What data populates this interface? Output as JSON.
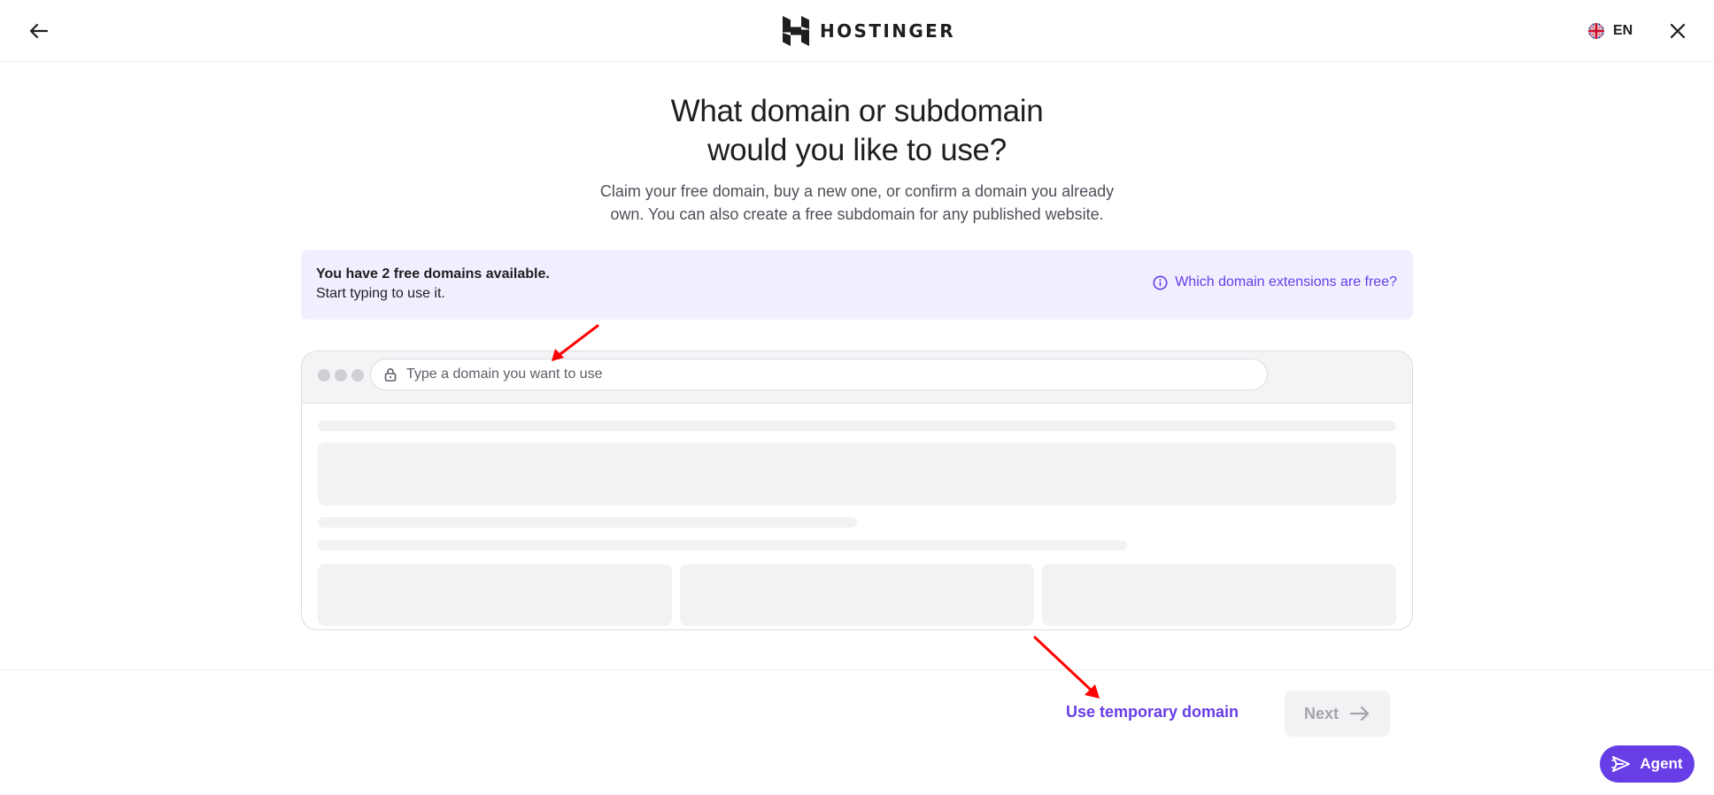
{
  "header": {
    "brand": "HOSTINGER",
    "language": "EN"
  },
  "main": {
    "heading_line1": "What domain or subdomain",
    "heading_line2": "would you like to use?",
    "subtitle_line1": "Claim your free domain, buy a new one, or confirm a domain you already",
    "subtitle_line2": "own. You can also create a free subdomain for any published website."
  },
  "banner": {
    "title": "You have 2 free domains available.",
    "subtitle": "Start typing to use it.",
    "link_label": "Which domain extensions are free?"
  },
  "domain_input": {
    "placeholder": "Type a domain you want to use",
    "value": ""
  },
  "footer": {
    "temporary_domain_label": "Use temporary domain",
    "next_label": "Next",
    "agent_label": "Agent"
  },
  "colors": {
    "accent": "#673de6",
    "banner_bg": "#f1efff",
    "annotation_arrow": "#ff0000"
  },
  "icons": {
    "back": "arrow-left-icon",
    "logo": "hostinger-logo-icon",
    "flag": "uk-flag-icon",
    "close": "close-icon",
    "info": "info-icon",
    "lock": "lock-icon",
    "next": "arrow-right-icon",
    "agent": "agent-icon"
  }
}
